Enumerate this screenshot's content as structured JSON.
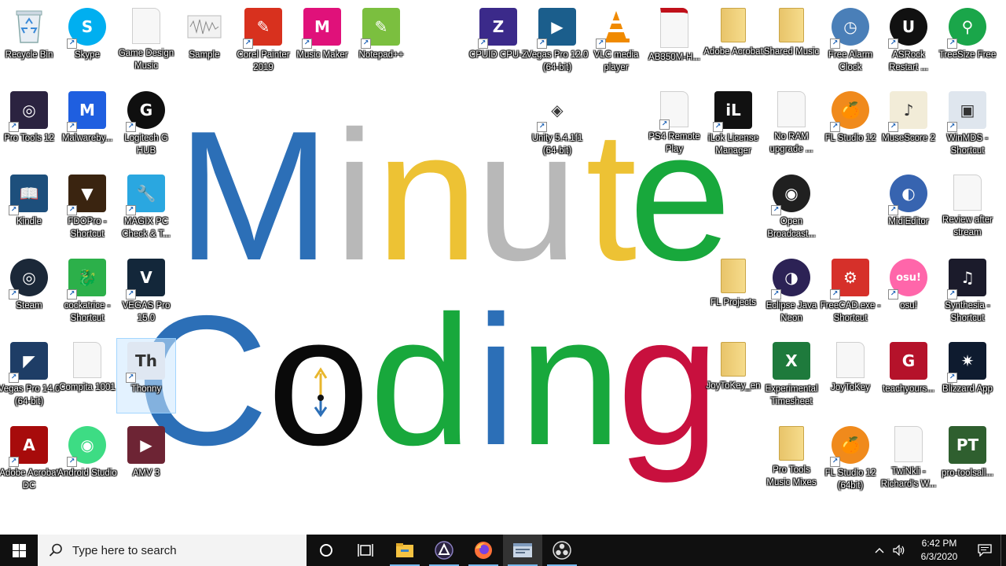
{
  "wallpaper": {
    "line1": [
      {
        "ch": "M",
        "color": "#2c6fb7"
      },
      {
        "ch": "i",
        "color": "#b8b8b8"
      },
      {
        "ch": "n",
        "color": "#edc234"
      },
      {
        "ch": "u",
        "color": "#b8b8b8"
      },
      {
        "ch": "t",
        "color": "#edc234"
      },
      {
        "ch": "e",
        "color": "#18a83c"
      }
    ],
    "line2": [
      {
        "ch": "C",
        "color": "#2c6fb7"
      },
      {
        "ch": "o",
        "color": "#0a0a0a"
      },
      {
        "ch": "d",
        "color": "#18a83c"
      },
      {
        "ch": "i",
        "color": "#2c6fb7"
      },
      {
        "ch": "n",
        "color": "#18a83c"
      },
      {
        "ch": "g",
        "color": "#c8103e"
      }
    ]
  },
  "desktop_icons": [
    {
      "label": "Recycle Bin",
      "icon": "recycle-bin-icon",
      "style": "bin",
      "color": "#9ab",
      "shortcut": false
    },
    {
      "label": "Skype",
      "icon": "skype-icon",
      "style": "round",
      "color": "#00aff0",
      "glyph": "S",
      "shortcut": true
    },
    {
      "label": "Game Design Music",
      "icon": "document-icon",
      "style": "doc",
      "shortcut": false
    },
    {
      "label": "Sample",
      "icon": "audio-file-icon",
      "style": "wave",
      "color": "#ccc",
      "shortcut": false
    },
    {
      "label": "Corel Painter 2019",
      "icon": "corel-painter-icon",
      "style": "box",
      "color": "#d8311e",
      "glyph": "✎",
      "shortcut": true
    },
    {
      "label": "Music Maker",
      "icon": "music-maker-icon",
      "style": "box",
      "color": "#e0117a",
      "glyph": "M",
      "shortcut": true
    },
    {
      "label": "Notepad++",
      "icon": "notepad-plus-plus-icon",
      "style": "box",
      "color": "#7bbf3f",
      "glyph": "✎",
      "shortcut": true
    },
    {
      "label": "CPUID CPU-Z",
      "icon": "cpu-z-icon",
      "style": "box",
      "color": "#3b2a8a",
      "glyph": "Z",
      "shortcut": true
    },
    {
      "label": "Vegas Pro 12.0 (64-bit)",
      "icon": "vegas-pro-icon",
      "style": "box",
      "color": "#1b5e8c",
      "glyph": "▶",
      "shortcut": true
    },
    {
      "label": "VLC media player",
      "icon": "vlc-icon",
      "style": "cone",
      "color": "#f08a00",
      "shortcut": true
    },
    {
      "label": "AB350M-H...",
      "icon": "pdf-document-icon",
      "style": "pdf",
      "color": "#fff",
      "shortcut": false
    },
    {
      "label": "Adobe Acrobat",
      "icon": "folder-icon",
      "style": "folder",
      "shortcut": false
    },
    {
      "label": "Shared Music",
      "icon": "folder-icon",
      "style": "folder",
      "shortcut": false
    },
    {
      "label": "Free Alarm Clock",
      "icon": "alarm-clock-icon",
      "style": "round",
      "color": "#4a7fb8",
      "glyph": "◷",
      "shortcut": true
    },
    {
      "label": "ASRock Restart ...",
      "icon": "asrock-uefi-icon",
      "style": "round",
      "color": "#111",
      "glyph": "U",
      "shortcut": true
    },
    {
      "label": "TreeSize Free",
      "icon": "treesize-icon",
      "style": "round",
      "color": "#1aa64a",
      "glyph": "⚲",
      "shortcut": true
    },
    {
      "label": "Pro Tools 12",
      "icon": "pro-tools-icon",
      "style": "box",
      "color": "#2b2340",
      "glyph": "◎",
      "shortcut": true
    },
    {
      "label": "Malwareby...",
      "icon": "malwarebytes-icon",
      "style": "box",
      "color": "#1f5fe0",
      "glyph": "M",
      "shortcut": true
    },
    {
      "label": "Logitech G HUB",
      "icon": "logitech-g-icon",
      "style": "round",
      "color": "#0f0f0f",
      "glyph": "G",
      "shortcut": true
    },
    {
      "label": "Unity 5.4.1f1 (64-bit)",
      "icon": "unity-icon",
      "style": "box",
      "color": "#ffffff",
      "glyph": "◈",
      "shortcut": true
    },
    {
      "label": "PS4 Remote Play",
      "icon": "document-icon",
      "style": "doc",
      "shortcut": true
    },
    {
      "label": "iLok License Manager",
      "icon": "ilok-icon",
      "style": "box",
      "color": "#111",
      "glyph": "iL",
      "shortcut": true
    },
    {
      "label": "No RAM upgrade ...",
      "icon": "image-file-icon",
      "style": "doc",
      "shortcut": false
    },
    {
      "label": "FL Studio 12",
      "icon": "fl-studio-icon",
      "style": "round",
      "color": "#f08a1c",
      "glyph": "🍊",
      "shortcut": true
    },
    {
      "label": "MuseScore 2",
      "icon": "musescore-icon",
      "style": "box",
      "color": "#f2ecd8",
      "glyph": "♪",
      "shortcut": true
    },
    {
      "label": "WinMDS - Shortcut",
      "icon": "winmds-icon",
      "style": "box",
      "color": "#dfe6ee",
      "glyph": "▣",
      "shortcut": true
    },
    {
      "label": "Kindle",
      "icon": "kindle-icon",
      "style": "box",
      "color": "#1d4f7c",
      "glyph": "📖",
      "shortcut": true
    },
    {
      "label": "FDOPro - Shortcut",
      "icon": "fdopro-icon",
      "style": "box",
      "color": "#3a2410",
      "glyph": "▼",
      "shortcut": true
    },
    {
      "label": "MAGIX PC Check & T...",
      "icon": "magix-pc-check-icon",
      "style": "box",
      "color": "#2aa7e0",
      "glyph": "🔧",
      "shortcut": true
    },
    {
      "label": "Open Broadcast...",
      "icon": "obs-icon",
      "style": "round",
      "color": "#202020",
      "glyph": "◉",
      "shortcut": true
    },
    {
      "label": "MidiEditor",
      "icon": "midieditor-icon",
      "style": "round",
      "color": "#3764b0",
      "glyph": "◐",
      "shortcut": true
    },
    {
      "label": "Review after stream",
      "icon": "document-icon",
      "style": "doc",
      "shortcut": false
    },
    {
      "label": "Steam",
      "icon": "steam-icon",
      "style": "round",
      "color": "#1b2838",
      "glyph": "◎",
      "shortcut": true
    },
    {
      "label": "cockatrice - Shortcut",
      "icon": "cockatrice-icon",
      "style": "box",
      "color": "#2cb04a",
      "glyph": "🐉",
      "shortcut": true
    },
    {
      "label": "VEGAS Pro 15.0",
      "icon": "vegas-pro-15-icon",
      "style": "box",
      "color": "#13273a",
      "glyph": "V",
      "shortcut": true
    },
    {
      "label": "FL Projects",
      "icon": "folder-icon",
      "style": "folder",
      "shortcut": false
    },
    {
      "label": "Eclipse Java Neon",
      "icon": "eclipse-icon",
      "style": "round",
      "color": "#2c2255",
      "glyph": "◑",
      "shortcut": true
    },
    {
      "label": "FreeCAD.exe - Shortcut",
      "icon": "freecad-icon",
      "style": "box",
      "color": "#d6302a",
      "glyph": "⚙",
      "shortcut": true
    },
    {
      "label": "osu!",
      "icon": "osu-icon",
      "style": "round",
      "color": "#ff66aa",
      "glyph": "osu!",
      "shortcut": true
    },
    {
      "label": "Synthesia - Shortcut",
      "icon": "synthesia-icon",
      "style": "box",
      "color": "#1b1b2b",
      "glyph": "♫",
      "shortcut": true
    },
    {
      "label": "Vegas Pro 14.0 (64-bit)",
      "icon": "vegas-pro-14-icon",
      "style": "box",
      "color": "#1e3d66",
      "glyph": "◤",
      "shortcut": true
    },
    {
      "label": "Compita 1001",
      "icon": "document-icon",
      "style": "doc",
      "shortcut": false
    },
    {
      "label": "Thonny",
      "icon": "thonny-icon",
      "style": "box",
      "color": "#dfe7f2",
      "glyph": "Th",
      "shortcut": true
    },
    {
      "label": "JoyToKey_en",
      "icon": "folder-icon",
      "style": "folder",
      "shortcut": false
    },
    {
      "label": "Experimental Timesheet",
      "icon": "excel-file-icon",
      "style": "box",
      "color": "#1e7a3c",
      "glyph": "X",
      "shortcut": false
    },
    {
      "label": "JoyToKey",
      "icon": "settings-file-icon",
      "style": "doc",
      "shortcut": false
    },
    {
      "label": "teachyours...",
      "icon": "guitar-book-icon",
      "style": "box",
      "color": "#b5122a",
      "glyph": "G",
      "shortcut": false
    },
    {
      "label": "Blizzard App",
      "icon": "blizzard-icon",
      "style": "box",
      "color": "#0e1b2f",
      "glyph": "✷",
      "shortcut": true
    },
    {
      "label": "Adobe Acrobat DC",
      "icon": "adobe-acrobat-icon",
      "style": "box",
      "color": "#a70b0b",
      "glyph": "A",
      "shortcut": true
    },
    {
      "label": "Android Studio",
      "icon": "android-studio-icon",
      "style": "round",
      "color": "#3ddc84",
      "glyph": "◉",
      "shortcut": true
    },
    {
      "label": "AMV 3",
      "icon": "video-file-icon",
      "style": "box",
      "color": "#6d2434",
      "glyph": "▶",
      "shortcut": false
    },
    {
      "label": "Pro Tools Music Mixes",
      "icon": "folder-icon",
      "style": "folder",
      "shortcut": false
    },
    {
      "label": "FL Studio 12 (64bit)",
      "icon": "fl-studio-64-icon",
      "style": "round",
      "color": "#f08a1c",
      "glyph": "🍊",
      "shortcut": true
    },
    {
      "label": "TwiNkli - Richard's W...",
      "icon": "audio-disc-icon",
      "style": "doc",
      "shortcut": false
    },
    {
      "label": "pro-toolsall...",
      "icon": "pdf-book-icon",
      "style": "box",
      "color": "#2f5f2f",
      "glyph": "PT",
      "shortcut": false
    }
  ],
  "taskbar": {
    "search_placeholder": "Type here to search",
    "time": "6:42 PM",
    "date": "6/3/2020",
    "pinned": [
      "task-view-cortana-icon",
      "task-view-icon",
      "file-explorer-icon",
      "pro-tools-taskbar-icon",
      "firefox-icon",
      "thonny-taskbar-icon",
      "obs-taskbar-icon"
    ]
  }
}
